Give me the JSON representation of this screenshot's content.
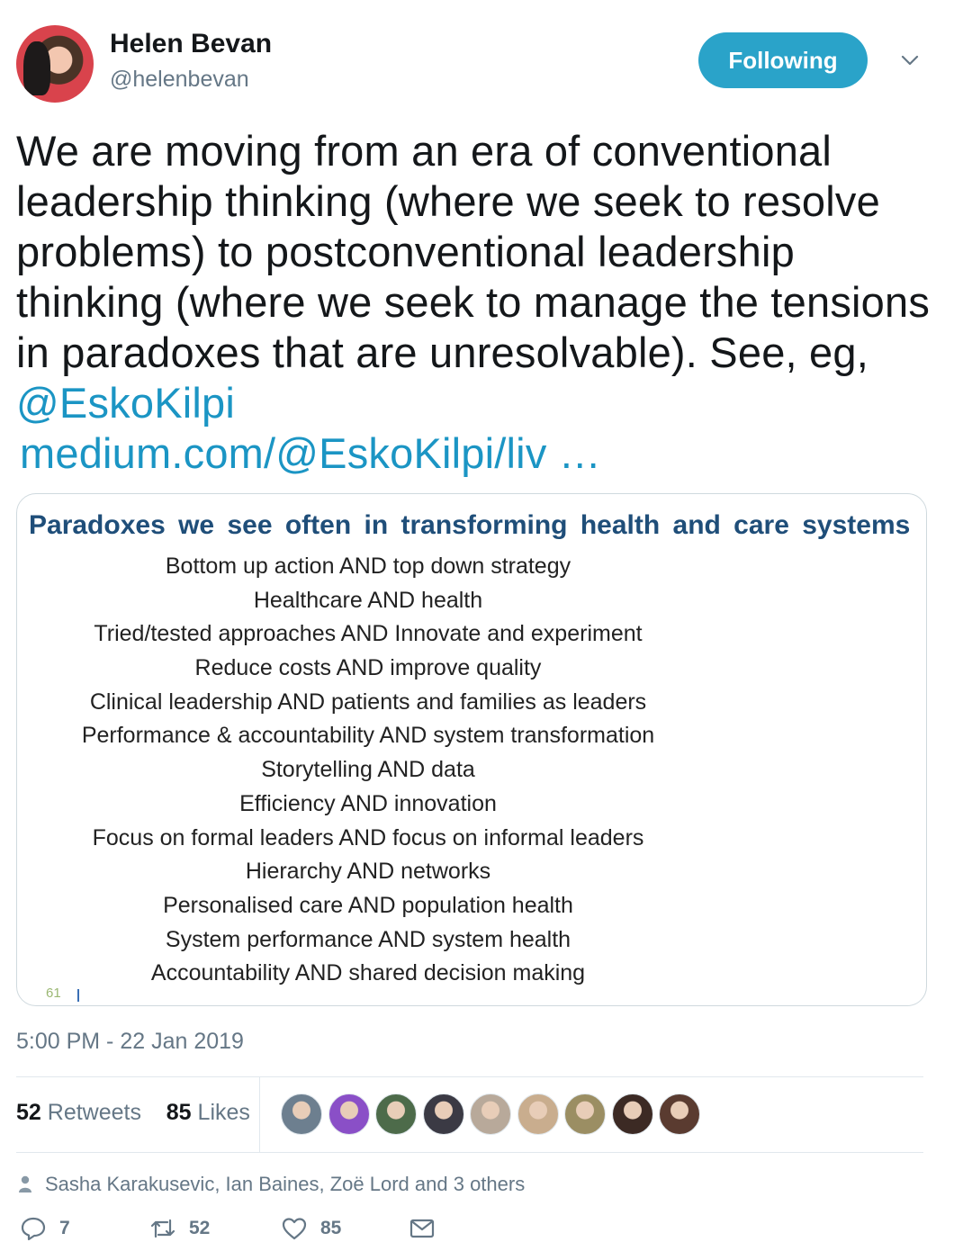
{
  "author": {
    "name": "Helen Bevan",
    "handle": "@helenbevan",
    "follow_label": "Following"
  },
  "tweet": {
    "text_main": "We are moving from an era of conventional leadership thinking (where we seek to resolve problems) to postconventional leadership thinking (where we seek to manage the tensions in paradoxes that are unresolvable). See, eg, ",
    "mention": "@EskoKilpi",
    "link": "medium.com/@EskoKilpi/liv …"
  },
  "slide": {
    "title": "Paradoxes  we see often in transforming  health and care systems",
    "lines": [
      "Bottom  up action AND top down  strategy",
      "Healthcare AND health",
      "Tried/tested  approaches  AND Innovate  and experiment",
      "Reduce costs AND improve quality",
      "Clinical leadership AND patients  and families  as leaders",
      "Performance & accountability AND  system transformation",
      "Storytelling AND data",
      "Efficiency AND innovation",
      "Focus on formal leaders AND focus on informal leaders",
      "Hierarchy AND networks",
      "Personalised care AND population  health",
      "System performance AND system health",
      "Accountability AND shared decision making"
    ],
    "page_number": "61"
  },
  "timestamp": "5:00 PM - 22 Jan 2019",
  "stats": {
    "retweets_count": "52",
    "retweets_label": "Retweets",
    "likes_count": "85",
    "likes_label": "Likes"
  },
  "likers_colors": [
    "#6d7f8f",
    "#8a4fc7",
    "#4d6b4a",
    "#3b3a44",
    "#b8a99a",
    "#c9ad8e",
    "#9b8e63",
    "#3c2a24",
    "#5a3b30"
  ],
  "replying_to": "Sasha Karakusevic, Ian Baines, Zoë Lord and 3 others",
  "actions": {
    "reply_count": "7",
    "retweet_count": "52",
    "like_count": "85"
  },
  "colors": {
    "accent": "#1b95c4",
    "button": "#2aa3c9",
    "slide_title": "#1f4e79",
    "muted": "#657786"
  }
}
